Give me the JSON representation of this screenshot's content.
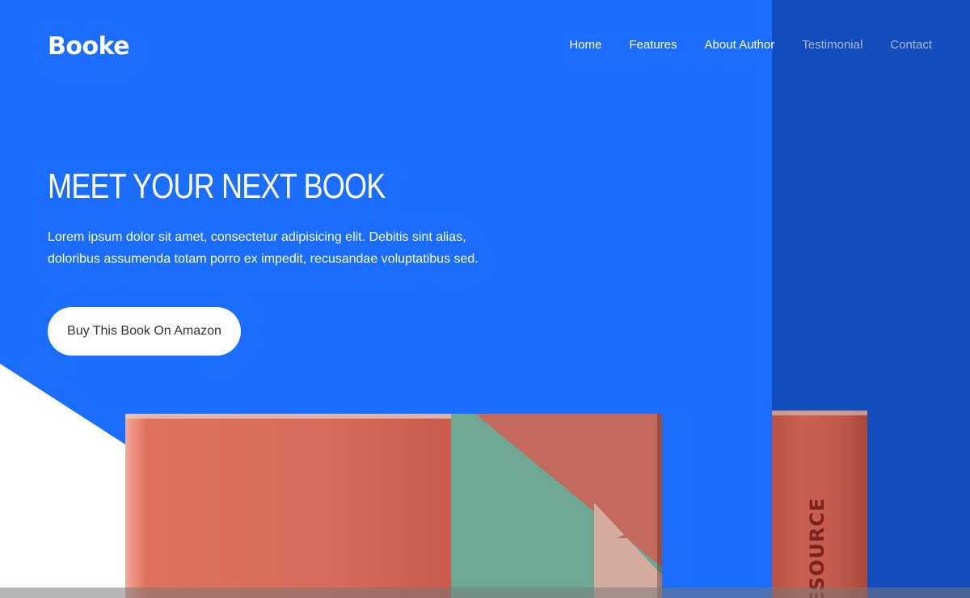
{
  "brand": {
    "logo": "Booke"
  },
  "nav": {
    "items": [
      {
        "label": "Home"
      },
      {
        "label": "Features"
      },
      {
        "label": "About Author"
      },
      {
        "label": "Testimonial"
      },
      {
        "label": "Contact"
      }
    ]
  },
  "hero": {
    "headline": "MEET YOUR NEXT BOOK",
    "lead": "Lorem ipsum dolor sit amet, consectetur adipisicing elit. Debitis sint alias, doloribus assumenda totam porro ex impedit, recusandae voluptatibus sed.",
    "cta_label": "Buy This Book On Amazon"
  },
  "book": {
    "spine_text": "RESOURCE"
  },
  "colors": {
    "primary": "#1a6dff",
    "panel": "#124cbd",
    "book_red": "#d6695a",
    "book_green": "#6ea894"
  }
}
